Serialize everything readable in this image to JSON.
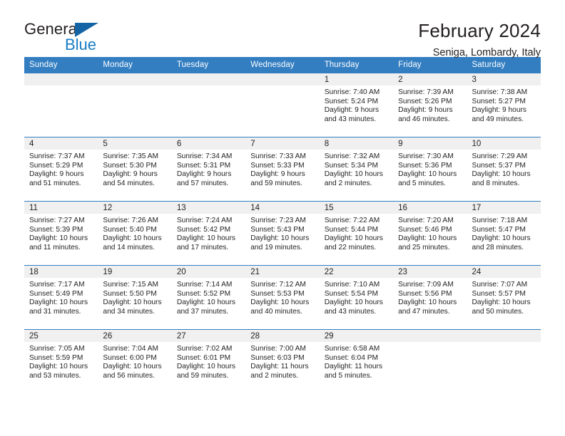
{
  "brand": {
    "name_top": "General",
    "name_bottom": "Blue",
    "triangle_icon": "triangle-icon",
    "color_dark": "#231f20",
    "color_blue": "#1a7cc4"
  },
  "header": {
    "title": "February 2024",
    "subtitle": "Seniga, Lombardy, Italy"
  },
  "theme": {
    "header_bg": "#337ec1",
    "header_text": "#ffffff",
    "band_bg": "#f0f0f0",
    "cell_bg": "#ffffff",
    "row_border": "#337ec1"
  },
  "calendar": {
    "weekday_headers": [
      "Sunday",
      "Monday",
      "Tuesday",
      "Wednesday",
      "Thursday",
      "Friday",
      "Saturday"
    ],
    "weeks": [
      [
        {
          "day": "",
          "lines": []
        },
        {
          "day": "",
          "lines": []
        },
        {
          "day": "",
          "lines": []
        },
        {
          "day": "",
          "lines": []
        },
        {
          "day": "1",
          "lines": [
            "Sunrise: 7:40 AM",
            "Sunset: 5:24 PM",
            "Daylight: 9 hours",
            "and 43 minutes."
          ]
        },
        {
          "day": "2",
          "lines": [
            "Sunrise: 7:39 AM",
            "Sunset: 5:26 PM",
            "Daylight: 9 hours",
            "and 46 minutes."
          ]
        },
        {
          "day": "3",
          "lines": [
            "Sunrise: 7:38 AM",
            "Sunset: 5:27 PM",
            "Daylight: 9 hours",
            "and 49 minutes."
          ]
        }
      ],
      [
        {
          "day": "4",
          "lines": [
            "Sunrise: 7:37 AM",
            "Sunset: 5:29 PM",
            "Daylight: 9 hours",
            "and 51 minutes."
          ]
        },
        {
          "day": "5",
          "lines": [
            "Sunrise: 7:35 AM",
            "Sunset: 5:30 PM",
            "Daylight: 9 hours",
            "and 54 minutes."
          ]
        },
        {
          "day": "6",
          "lines": [
            "Sunrise: 7:34 AM",
            "Sunset: 5:31 PM",
            "Daylight: 9 hours",
            "and 57 minutes."
          ]
        },
        {
          "day": "7",
          "lines": [
            "Sunrise: 7:33 AM",
            "Sunset: 5:33 PM",
            "Daylight: 9 hours",
            "and 59 minutes."
          ]
        },
        {
          "day": "8",
          "lines": [
            "Sunrise: 7:32 AM",
            "Sunset: 5:34 PM",
            "Daylight: 10 hours",
            "and 2 minutes."
          ]
        },
        {
          "day": "9",
          "lines": [
            "Sunrise: 7:30 AM",
            "Sunset: 5:36 PM",
            "Daylight: 10 hours",
            "and 5 minutes."
          ]
        },
        {
          "day": "10",
          "lines": [
            "Sunrise: 7:29 AM",
            "Sunset: 5:37 PM",
            "Daylight: 10 hours",
            "and 8 minutes."
          ]
        }
      ],
      [
        {
          "day": "11",
          "lines": [
            "Sunrise: 7:27 AM",
            "Sunset: 5:39 PM",
            "Daylight: 10 hours",
            "and 11 minutes."
          ]
        },
        {
          "day": "12",
          "lines": [
            "Sunrise: 7:26 AM",
            "Sunset: 5:40 PM",
            "Daylight: 10 hours",
            "and 14 minutes."
          ]
        },
        {
          "day": "13",
          "lines": [
            "Sunrise: 7:24 AM",
            "Sunset: 5:42 PM",
            "Daylight: 10 hours",
            "and 17 minutes."
          ]
        },
        {
          "day": "14",
          "lines": [
            "Sunrise: 7:23 AM",
            "Sunset: 5:43 PM",
            "Daylight: 10 hours",
            "and 19 minutes."
          ]
        },
        {
          "day": "15",
          "lines": [
            "Sunrise: 7:22 AM",
            "Sunset: 5:44 PM",
            "Daylight: 10 hours",
            "and 22 minutes."
          ]
        },
        {
          "day": "16",
          "lines": [
            "Sunrise: 7:20 AM",
            "Sunset: 5:46 PM",
            "Daylight: 10 hours",
            "and 25 minutes."
          ]
        },
        {
          "day": "17",
          "lines": [
            "Sunrise: 7:18 AM",
            "Sunset: 5:47 PM",
            "Daylight: 10 hours",
            "and 28 minutes."
          ]
        }
      ],
      [
        {
          "day": "18",
          "lines": [
            "Sunrise: 7:17 AM",
            "Sunset: 5:49 PM",
            "Daylight: 10 hours",
            "and 31 minutes."
          ]
        },
        {
          "day": "19",
          "lines": [
            "Sunrise: 7:15 AM",
            "Sunset: 5:50 PM",
            "Daylight: 10 hours",
            "and 34 minutes."
          ]
        },
        {
          "day": "20",
          "lines": [
            "Sunrise: 7:14 AM",
            "Sunset: 5:52 PM",
            "Daylight: 10 hours",
            "and 37 minutes."
          ]
        },
        {
          "day": "21",
          "lines": [
            "Sunrise: 7:12 AM",
            "Sunset: 5:53 PM",
            "Daylight: 10 hours",
            "and 40 minutes."
          ]
        },
        {
          "day": "22",
          "lines": [
            "Sunrise: 7:10 AM",
            "Sunset: 5:54 PM",
            "Daylight: 10 hours",
            "and 43 minutes."
          ]
        },
        {
          "day": "23",
          "lines": [
            "Sunrise: 7:09 AM",
            "Sunset: 5:56 PM",
            "Daylight: 10 hours",
            "and 47 minutes."
          ]
        },
        {
          "day": "24",
          "lines": [
            "Sunrise: 7:07 AM",
            "Sunset: 5:57 PM",
            "Daylight: 10 hours",
            "and 50 minutes."
          ]
        }
      ],
      [
        {
          "day": "25",
          "lines": [
            "Sunrise: 7:05 AM",
            "Sunset: 5:59 PM",
            "Daylight: 10 hours",
            "and 53 minutes."
          ]
        },
        {
          "day": "26",
          "lines": [
            "Sunrise: 7:04 AM",
            "Sunset: 6:00 PM",
            "Daylight: 10 hours",
            "and 56 minutes."
          ]
        },
        {
          "day": "27",
          "lines": [
            "Sunrise: 7:02 AM",
            "Sunset: 6:01 PM",
            "Daylight: 10 hours",
            "and 59 minutes."
          ]
        },
        {
          "day": "28",
          "lines": [
            "Sunrise: 7:00 AM",
            "Sunset: 6:03 PM",
            "Daylight: 11 hours",
            "and 2 minutes."
          ]
        },
        {
          "day": "29",
          "lines": [
            "Sunrise: 6:58 AM",
            "Sunset: 6:04 PM",
            "Daylight: 11 hours",
            "and 5 minutes."
          ]
        },
        {
          "day": "",
          "lines": []
        },
        {
          "day": "",
          "lines": []
        }
      ]
    ]
  }
}
